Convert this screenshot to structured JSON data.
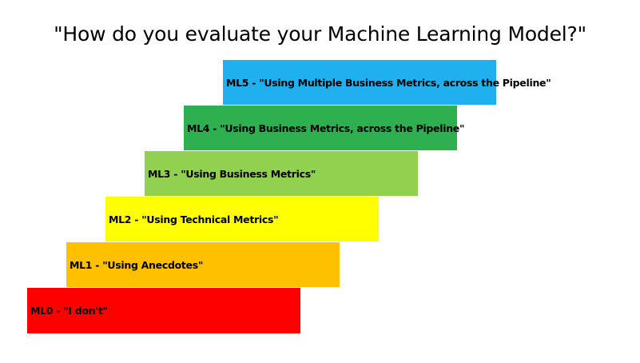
{
  "title": "\"How do you evaluate your Machine Learning Model?\"",
  "steps": [
    {
      "label": "ML0 - \"I don't\"",
      "color": "#ff0000"
    },
    {
      "label": "ML1 - \"Using Anecdotes\"",
      "color": "#ffc000"
    },
    {
      "label": "ML2 - \"Using Technical Metrics\"",
      "color": "#ffff00"
    },
    {
      "label": "ML3 - \"Using Business Metrics\"",
      "color": "#92d050"
    },
    {
      "label": "ML4 - \"Using Business Metrics, across the Pipeline\"",
      "color": "#2fb050"
    },
    {
      "label": "ML5 - \"Using Multiple Business Metrics, across the Pipeline\"",
      "color": "#20b0f0"
    }
  ]
}
